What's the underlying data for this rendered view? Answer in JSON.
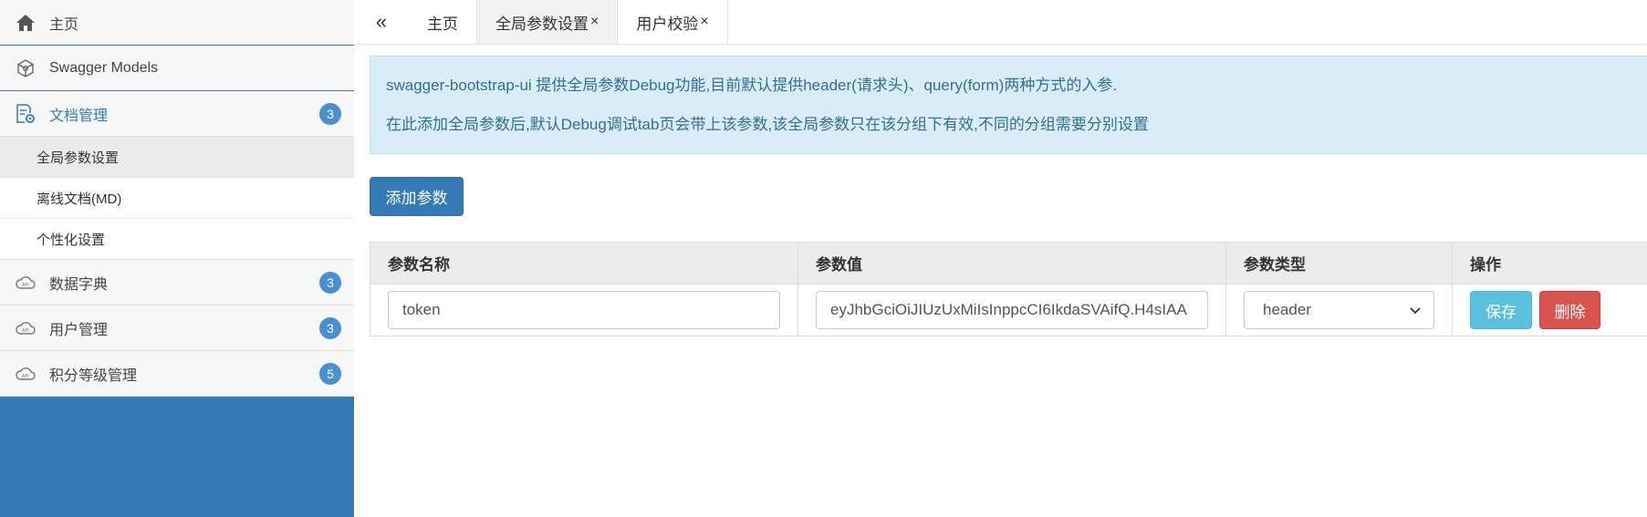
{
  "sidebar": {
    "home": {
      "label": "主页",
      "icon": "home-icon"
    },
    "models": {
      "label": "Swagger Models",
      "icon": "cube-icon"
    },
    "docs": {
      "label": "文档管理",
      "badge": "3",
      "icon": "doc-settings-icon",
      "children": [
        {
          "label": "全局参数设置"
        },
        {
          "label": "离线文档(MD)"
        },
        {
          "label": "个性化设置"
        }
      ]
    },
    "groups": [
      {
        "label": "数据字典",
        "badge": "3",
        "icon": "api-cloud-icon"
      },
      {
        "label": "用户管理",
        "badge": "3",
        "icon": "api-cloud-icon"
      },
      {
        "label": "积分等级管理",
        "badge": "5",
        "icon": "api-cloud-icon"
      }
    ]
  },
  "tabs": {
    "toggle": "«",
    "items": [
      {
        "label": "主页"
      },
      {
        "label": "全局参数设置",
        "close": "×"
      },
      {
        "label": "用户校验",
        "close": "×"
      }
    ]
  },
  "alert": {
    "line1": "swagger-bootstrap-ui 提供全局参数Debug功能,目前默认提供header(请求头)、query(form)两种方式的入参.",
    "line2": "在此添加全局参数后,默认Debug调试tab页会带上该参数,该全局参数只在该分组下有效,不同的分组需要分别设置"
  },
  "add_button": "添加参数",
  "table": {
    "headers": [
      "参数名称",
      "参数值",
      "参数类型",
      "操作"
    ],
    "row": {
      "name": "token",
      "value": "eyJhbGciOiJIUzUxMiIsInppcCI6IkdaSVAifQ.H4sIAA",
      "type": "header",
      "save": "保存",
      "delete": "删除"
    }
  },
  "colors": {
    "primary": "#337ab7",
    "info": "#5bc0de",
    "danger": "#d9534f",
    "alert_bg": "#d9edf7"
  }
}
